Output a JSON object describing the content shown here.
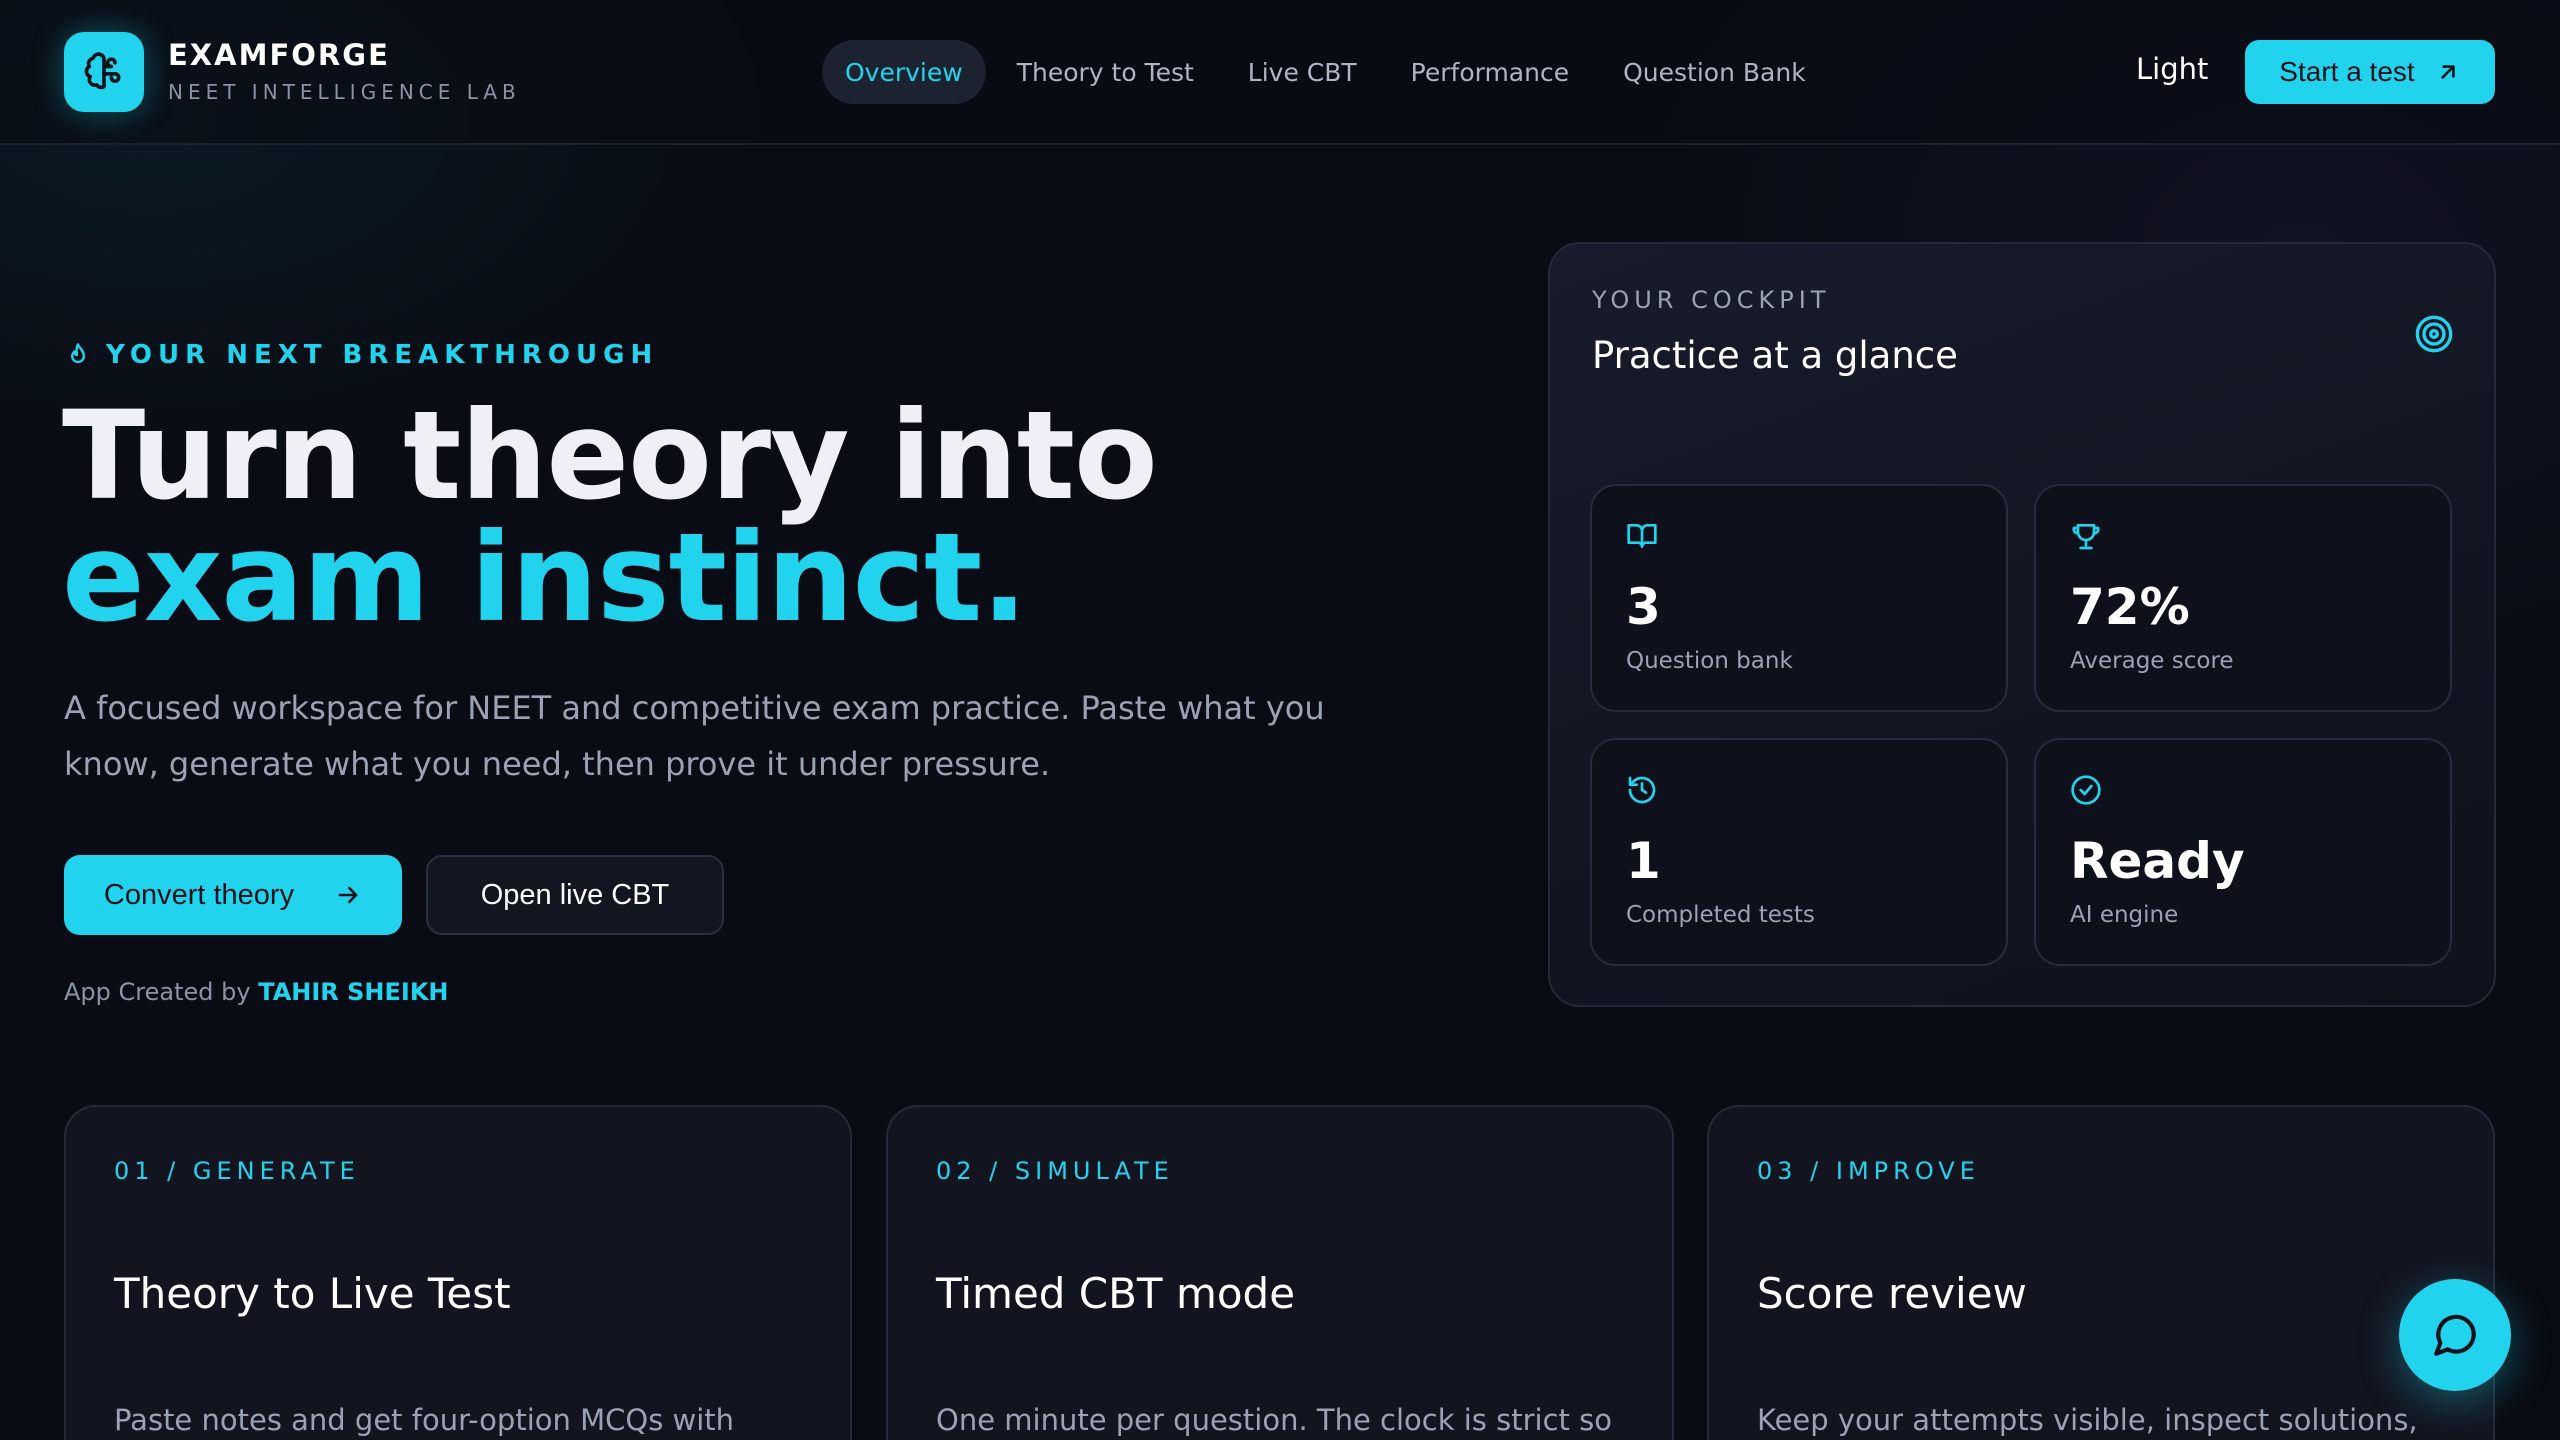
{
  "brand": {
    "name": "EXAMFORGE",
    "tagline": "NEET INTELLIGENCE LAB",
    "logo_icon": "brain-icon"
  },
  "nav": {
    "items": [
      {
        "label": "Overview",
        "active": true
      },
      {
        "label": "Theory to Test",
        "active": false
      },
      {
        "label": "Live CBT",
        "active": false
      },
      {
        "label": "Performance",
        "active": false
      },
      {
        "label": "Question Bank",
        "active": false
      }
    ],
    "theme_toggle": "Light",
    "start_label": "Start a test"
  },
  "hero": {
    "eyebrow": "YOUR NEXT BREAKTHROUGH",
    "title_line1": "Turn theory into",
    "title_line2": "exam instinct.",
    "description": "A focused workspace for NEET and competitive exam practice. Paste what you know, generate what you need, then prove it under pressure.",
    "primary_cta": "Convert theory",
    "secondary_cta": "Open live CBT",
    "credit_prefix": "App Created by",
    "credit_author": "TAHIR SHEIKH"
  },
  "cockpit": {
    "eyebrow": "YOUR COCKPIT",
    "title": "Practice at a glance",
    "stats": [
      {
        "icon": "book-open-icon",
        "value": "3",
        "label": "Question bank"
      },
      {
        "icon": "trophy-icon",
        "value": "72%",
        "label": "Average score"
      },
      {
        "icon": "history-icon",
        "value": "1",
        "label": "Completed tests"
      },
      {
        "icon": "check-circle-icon",
        "value": "Ready",
        "label": "AI engine"
      }
    ]
  },
  "features": [
    {
      "num": "01 / GENERATE",
      "title": "Theory to Live Test",
      "desc": "Paste notes and get four-option MCQs with"
    },
    {
      "num": "02 / SIMULATE",
      "title": "Timed CBT mode",
      "desc": "One minute per question. The clock is strict so"
    },
    {
      "num": "03 / IMPROVE",
      "title": "Score review",
      "desc": "Keep your attempts visible, inspect solutions,"
    }
  ],
  "colors": {
    "accent": "#22d3ee",
    "background": "#090c14",
    "card": "#0e111b"
  }
}
